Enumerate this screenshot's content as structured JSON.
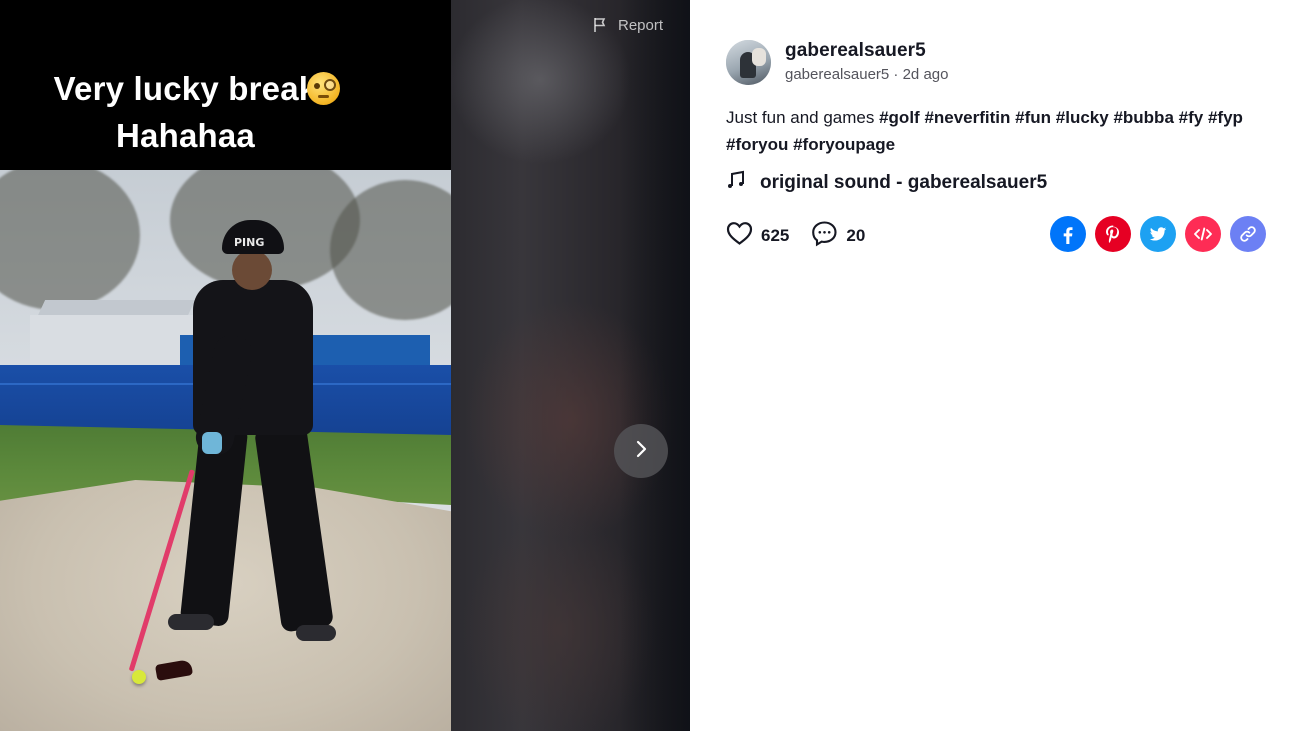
{
  "video": {
    "caption_line1": "Very lucky break",
    "caption_line2": "Hahahaa",
    "caption_emoji": "face-with-monocle",
    "cap_logo": "PING",
    "report_label": "Report"
  },
  "author": {
    "username": "gaberealsauer5",
    "handle": "gaberealsauer5",
    "separator": " · ",
    "posted": "2d ago"
  },
  "description": {
    "text": "Just fun and games ",
    "hashtags": [
      "#golf",
      "#neverfitin",
      "#fun",
      "#lucky",
      "#bubba",
      "#fy",
      "#fyp",
      "#foryou",
      "#foryoupage"
    ]
  },
  "sound": {
    "label": "original sound - gaberealsauer5",
    "icon": "music-note-icon"
  },
  "stats": {
    "likes": "625",
    "comments": "20"
  },
  "share": {
    "buttons": [
      {
        "name": "facebook",
        "color": "#0075fa"
      },
      {
        "name": "pinterest",
        "color": "#e60023"
      },
      {
        "name": "twitter",
        "color": "#1da1f2"
      },
      {
        "name": "embed",
        "color": "#fe2c55"
      },
      {
        "name": "copy-link",
        "color": "#6c80f4"
      }
    ]
  },
  "colors": {
    "text_primary": "#161823",
    "text_secondary": "#54545c"
  }
}
